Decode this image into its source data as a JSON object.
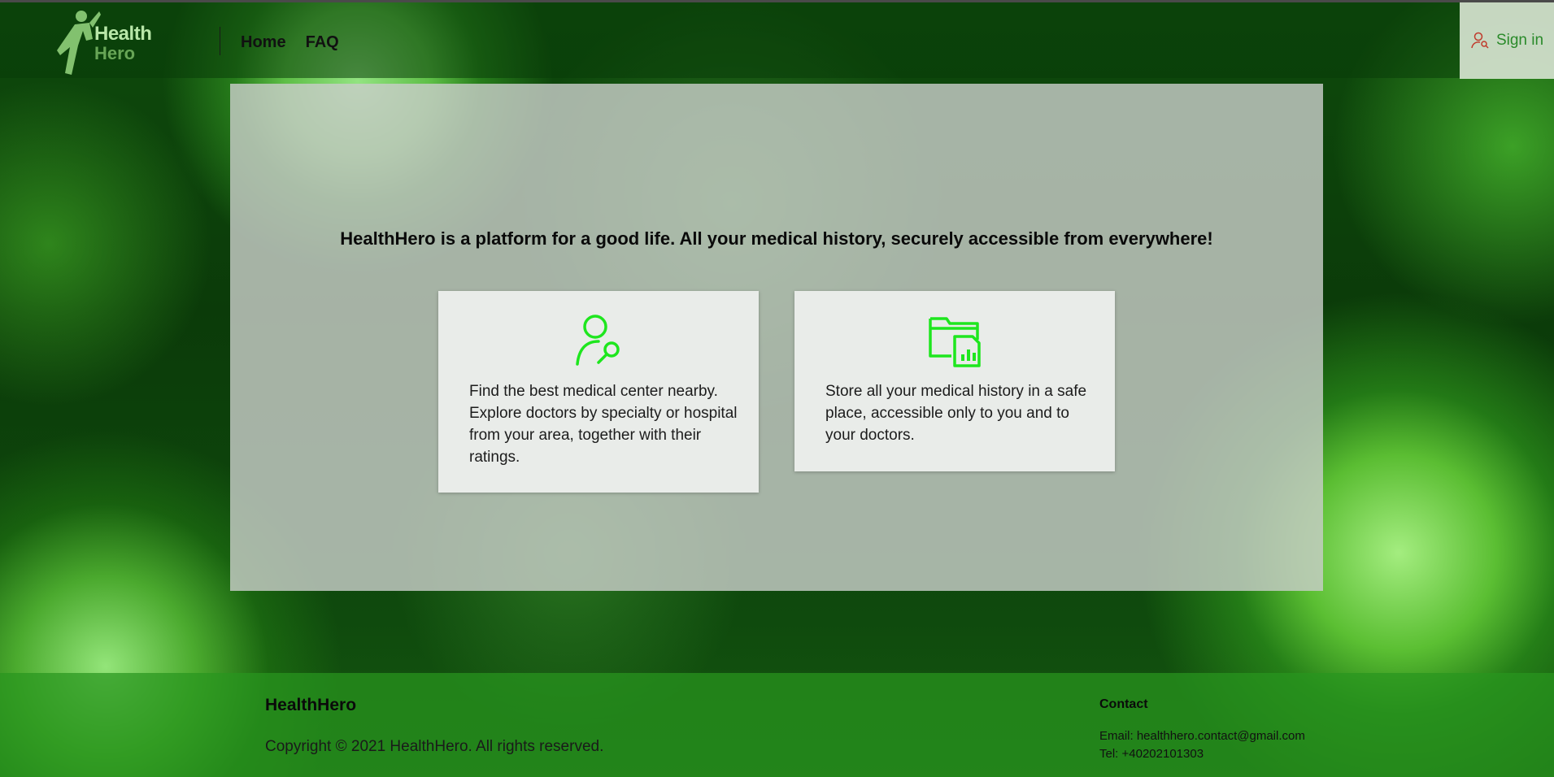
{
  "header": {
    "logo_line1": "Health",
    "logo_line2": "Hero",
    "nav": [
      {
        "label": "Home"
      },
      {
        "label": "FAQ"
      }
    ],
    "signin_label": "Sign in"
  },
  "main": {
    "tagline": "HealthHero is a platform for a good life. All your medical history, securely accessible from everywhere!",
    "cards": [
      {
        "icon": "user-search-icon",
        "text": "Find the best medical center nearby. Explore doctors by specialty or hospital from your area, together with their ratings."
      },
      {
        "icon": "folder-chart-icon",
        "text": "Store all your medical history in a safe place, accessible only to you and to your doctors."
      }
    ]
  },
  "footer": {
    "brand": "HealthHero",
    "copyright": "Copyright © 2021 HealthHero. All rights reserved.",
    "contact_title": "Contact",
    "email": "Email: healthhero.contact@gmail.com",
    "tel": "Tel: +40202101303"
  },
  "colors": {
    "accent_green": "#1ee61e",
    "footer_green": "#2a9a22",
    "signin_text": "#2a8a2a"
  }
}
